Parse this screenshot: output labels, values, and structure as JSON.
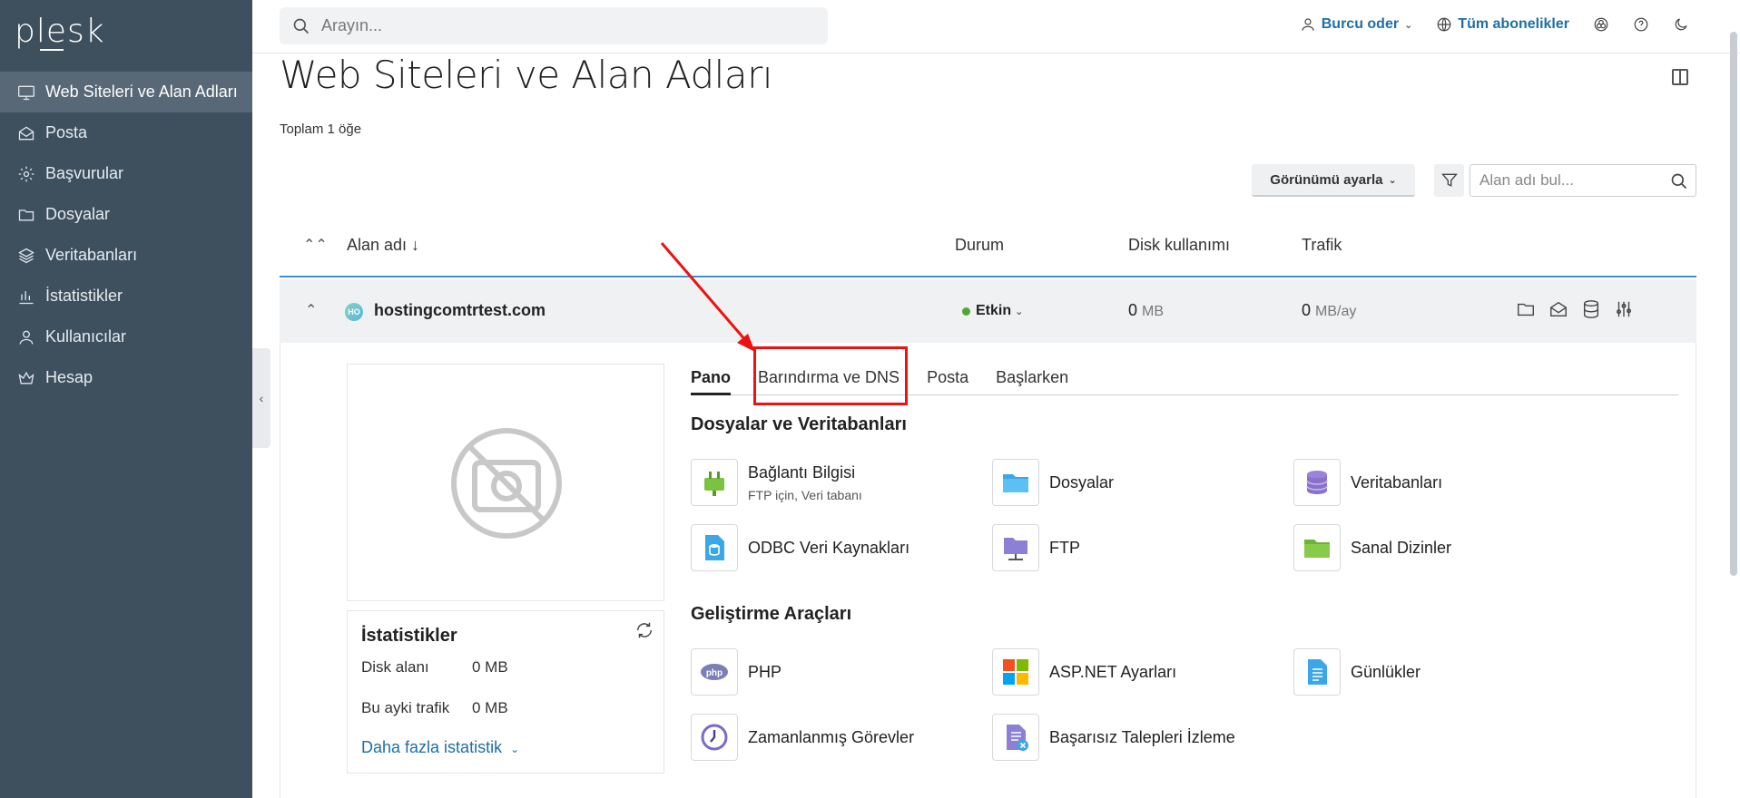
{
  "brand": "plesk",
  "sidebar": {
    "items": [
      {
        "label": "Web Siteleri ve Alan Adları",
        "icon": "monitor-icon",
        "active": true
      },
      {
        "label": "Posta",
        "icon": "mail-icon"
      },
      {
        "label": "Başvurular",
        "icon": "gear-icon"
      },
      {
        "label": "Dosyalar",
        "icon": "folder-icon"
      },
      {
        "label": "Veritabanları",
        "icon": "layers-icon"
      },
      {
        "label": "İstatistikler",
        "icon": "bar-chart-icon"
      },
      {
        "label": "Kullanıcılar",
        "icon": "user-icon"
      },
      {
        "label": "Hesap",
        "icon": "crown-icon"
      }
    ]
  },
  "topbar": {
    "search_placeholder": "Arayın...",
    "user": "Burcu oder",
    "subscriptions": "Tüm abonelikler"
  },
  "page": {
    "title": "Web Siteleri ve Alan Adları",
    "total": "Toplam 1 öğe",
    "view_button": "Görünümü ayarla",
    "domain_search_placeholder": "Alan adı bul..."
  },
  "table": {
    "col_domain": "Alan adı ↓",
    "col_status": "Durum",
    "col_disk": "Disk kullanımı",
    "col_traffic": "Trafik"
  },
  "row": {
    "favicon": "HO",
    "domain": "hostingcomtrtest.com",
    "status": "Etkin",
    "disk_value": "0",
    "disk_unit": "MB",
    "traffic_value": "0",
    "traffic_unit": "MB/ay"
  },
  "stats": {
    "title": "İstatistikler",
    "disk_label": "Disk alanı",
    "disk_value": "0 MB",
    "traffic_label": "Bu ayki trafik",
    "traffic_value": "0 MB",
    "more": "Daha fazla istatistik"
  },
  "tabs": [
    "Pano",
    "Barındırma ve DNS",
    "Posta",
    "Başlarken"
  ],
  "sections": {
    "files_title": "Dosyalar ve Veritabanları",
    "dev_title": "Geliştirme Araçları"
  },
  "tools": {
    "connection": {
      "label": "Bağlantı Bilgisi",
      "sub": "FTP için, Veri tabanı"
    },
    "files": "Dosyalar",
    "databases": "Veritabanları",
    "odbc": "ODBC Veri Kaynakları",
    "ftp": "FTP",
    "virtual_dirs": "Sanal Dizinler",
    "php": "PHP",
    "aspnet": "ASP.NET Ayarları",
    "logs": "Günlükler",
    "scheduled": "Zamanlanmış Görevler",
    "failed_requests": "Başarısız Talepleri İzleme"
  },
  "colors": {
    "sidebar": "#3e4f5e",
    "accent": "#1d6fa5",
    "highlight": "#ee1111"
  }
}
